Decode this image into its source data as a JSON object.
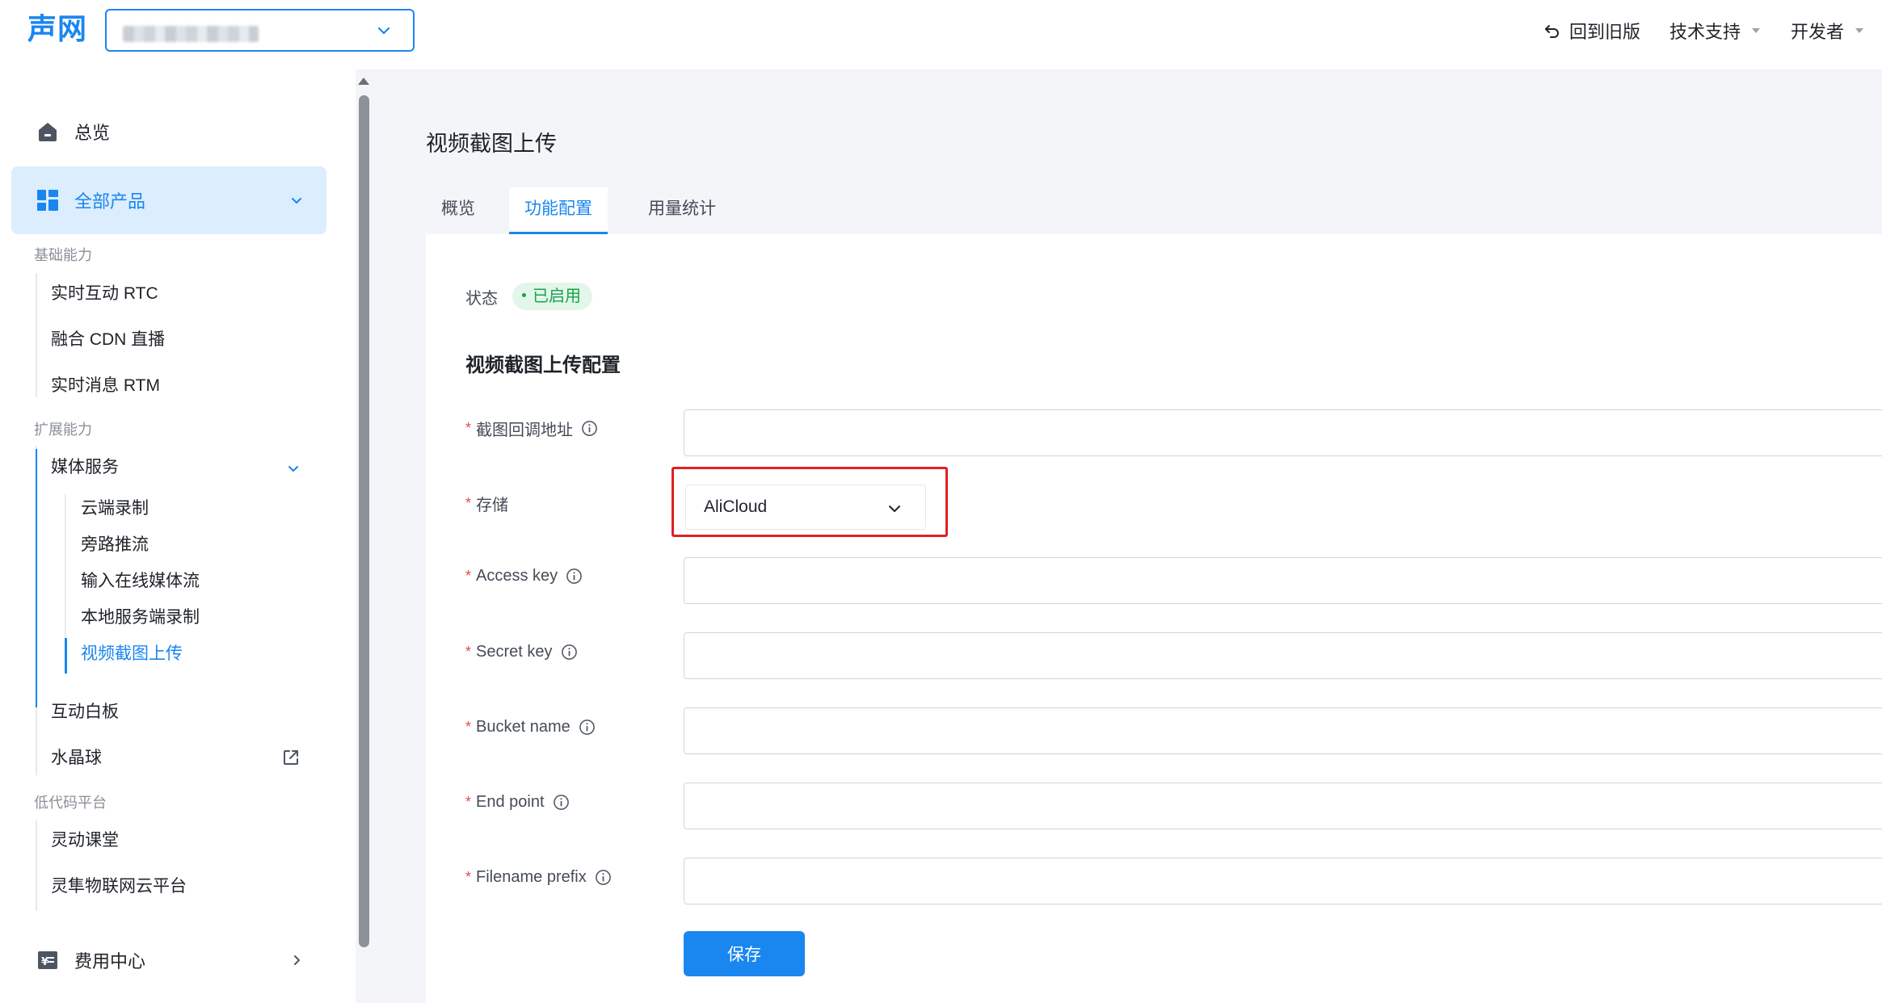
{
  "header": {
    "logo": "声网",
    "right_nav": {
      "back_to_old": "回到旧版",
      "tech_support": "技术支持",
      "developer": "开发者"
    }
  },
  "sidebar": {
    "overview": "总览",
    "all_products": "全部产品",
    "groups": {
      "basic": "基础能力",
      "extended": "扩展能力",
      "lowcode": "低代码平台"
    },
    "basic_items": [
      "实时互动 RTC",
      "融合 CDN 直播",
      "实时消息 RTM"
    ],
    "media_service": "媒体服务",
    "media_sub_items": [
      "云端录制",
      "旁路推流",
      "输入在线媒体流",
      "本地服务端录制",
      "视频截图上传"
    ],
    "extended_items": [
      "互动白板",
      "水晶球"
    ],
    "lowcode_items": [
      "灵动课堂",
      "灵隼物联网云平台"
    ],
    "billing": "费用中心"
  },
  "main": {
    "title": "视频截图上传",
    "tabs": [
      "概览",
      "功能配置",
      "用量统计"
    ],
    "active_tab": "功能配置",
    "status_label": "状态",
    "status_value": "已启用",
    "section_title": "视频截图上传配置",
    "fields": {
      "callback_url": "截图回调地址",
      "storage": "存储",
      "storage_value": "AliCloud",
      "access_key": "Access key",
      "secret_key": "Secret key",
      "bucket_name": "Bucket name",
      "end_point": "End point",
      "filename_prefix": "Filename prefix"
    },
    "save_label": "保存"
  },
  "colors": {
    "accent": "#1a86f0",
    "status_green": "#16a34a",
    "highlight_red": "#e02020",
    "required_red": "#e5484d"
  }
}
